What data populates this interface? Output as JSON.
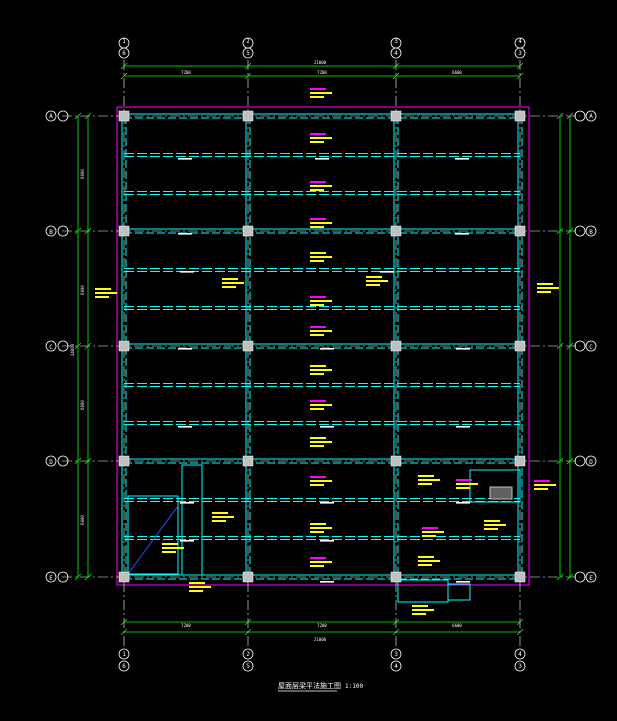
{
  "drawing": {
    "title": "屋面层梁平法施工图",
    "scale": "1:100"
  },
  "axes": {
    "vertical": [
      "1",
      "2",
      "3",
      "4"
    ],
    "vertical_alt": [
      "6",
      "5",
      "4",
      "3"
    ],
    "horizontal": [
      "A",
      "B",
      "C",
      "D",
      "E"
    ]
  },
  "dimensions": {
    "total": "21000",
    "bays": [
      "7200",
      "7200",
      "6600"
    ],
    "left_total": "24000",
    "rows": [
      "6000",
      "6000",
      "6000",
      "6000"
    ]
  },
  "colors": {
    "background": "#000000",
    "axis": "#ffffff",
    "dimension": "#00ff00",
    "beam": "#00ffff",
    "column": "#c0c0c0",
    "note_magenta": "#ff00ff",
    "note_yellow": "#ffff00",
    "slab_edge": "#ff00ff"
  }
}
